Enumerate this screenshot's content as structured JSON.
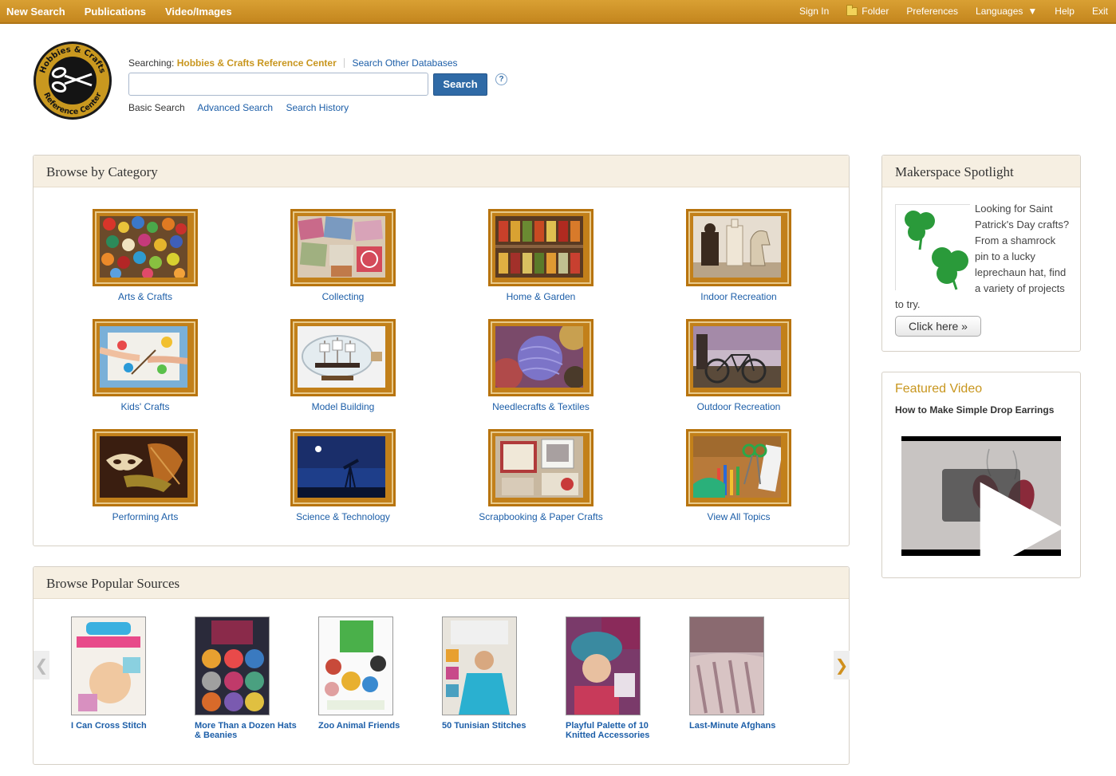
{
  "topnav": {
    "left": [
      "New Search",
      "Publications",
      "Video/Images"
    ],
    "sign_in": "Sign In",
    "folder": "Folder",
    "preferences": "Preferences",
    "languages": "Languages",
    "help": "Help",
    "exit": "Exit"
  },
  "logo": {
    "text_top": "Hobbies & Crafts",
    "text_bottom": "Reference Center"
  },
  "search": {
    "searching_label": "Searching:",
    "database": "Hobbies & Crafts Reference Center",
    "other_databases": "Search Other Databases",
    "input_value": "",
    "button": "Search",
    "help": "?",
    "links": [
      "Basic Search",
      "Advanced Search",
      "Search History"
    ]
  },
  "browse_category": {
    "title": "Browse by Category",
    "items": [
      "Arts & Crafts",
      "Collecting",
      "Home & Garden",
      "Indoor Recreation",
      "Kids' Crafts",
      "Model Building",
      "Needlecrafts & Textiles",
      "Outdoor Recreation",
      "Performing Arts",
      "Science & Technology",
      "Scrapbooking & Paper Crafts",
      "View All Topics"
    ]
  },
  "popular_sources": {
    "title": "Browse Popular Sources",
    "prev": "❮",
    "next": "❯",
    "items": [
      {
        "label": "I Can Cross Stitch"
      },
      {
        "label": "More Than a Dozen Hats & Beanies"
      },
      {
        "label": "Zoo Animal Friends"
      },
      {
        "label": "50 Tunisian Stitches"
      },
      {
        "label": "Playful Palette of 10 Knitted Accessories"
      },
      {
        "label": "Last-Minute Afghans"
      }
    ]
  },
  "makerspace": {
    "title": "Makerspace Spotlight",
    "text": "Looking for Saint Patrick's Day crafts? From a shamrock pin to a lucky leprechaun hat, find a variety of projects to try.",
    "button": "Click here »"
  },
  "featured_video": {
    "title": "Featured Video",
    "subtitle": "How to Make Simple Drop Earrings"
  }
}
